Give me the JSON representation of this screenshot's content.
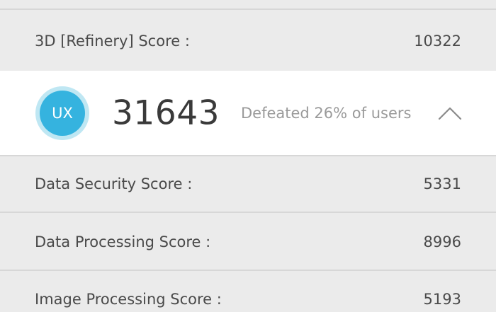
{
  "scores": {
    "refinery": {
      "label": "3D [Refinery] Score :",
      "value": "10322"
    },
    "data_security": {
      "label": "Data Security Score :",
      "value": "5331"
    },
    "data_processing": {
      "label": "Data Processing Score :",
      "value": "8996"
    },
    "image_processing": {
      "label": "Image Processing Score :",
      "value": "5193"
    }
  },
  "ux": {
    "badge": "UX",
    "score": "31643",
    "defeated": "Defeated 26% of users",
    "badge_color": "#35b3df",
    "ring_color": "#bfe7f3",
    "toggle_icon": "chevron-up-icon"
  }
}
